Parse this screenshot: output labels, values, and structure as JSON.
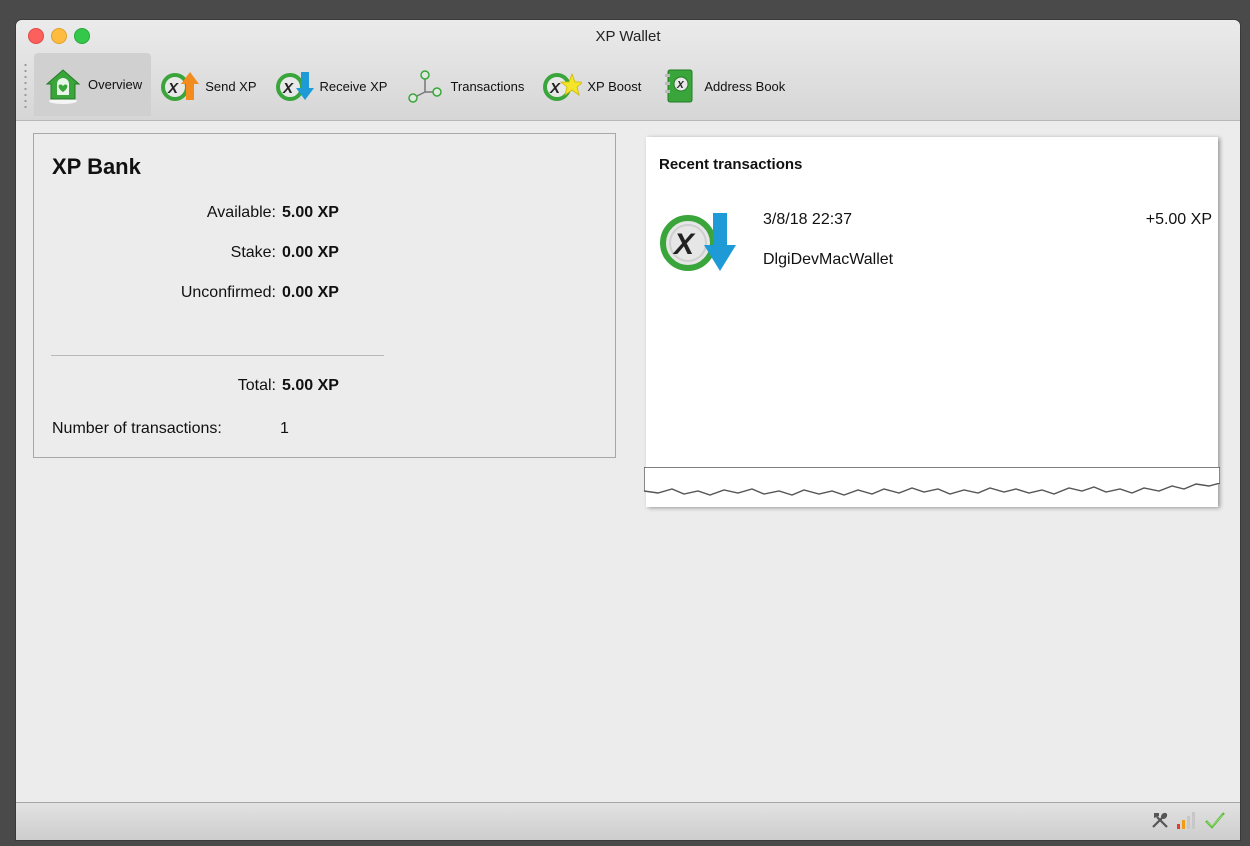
{
  "window": {
    "title": "XP Wallet"
  },
  "toolbar": {
    "tabs": [
      {
        "label": "Overview",
        "icon": "house-icon",
        "active": true
      },
      {
        "label": "Send XP",
        "icon": "send-xp-icon",
        "active": false
      },
      {
        "label": "Receive XP",
        "icon": "receive-xp-icon",
        "active": false
      },
      {
        "label": "Transactions",
        "icon": "transactions-icon",
        "active": false
      },
      {
        "label": "XP Boost",
        "icon": "xp-boost-icon",
        "active": false
      },
      {
        "label": "Address Book",
        "icon": "address-book-icon",
        "active": false
      }
    ]
  },
  "bank": {
    "title": "XP Bank",
    "available_label": "Available:",
    "available_value": "5.00 XP",
    "stake_label": "Stake:",
    "stake_value": "0.00 XP",
    "unconfirmed_label": "Unconfirmed:",
    "unconfirmed_value": "0.00 XP",
    "total_label": "Total:",
    "total_value": "5.00 XP",
    "num_tx_label": "Number of transactions:",
    "num_tx_value": "1"
  },
  "recent": {
    "title": "Recent transactions",
    "transactions": [
      {
        "date": "3/8/18 22:37",
        "amount": "+5.00 XP",
        "label": "DlgiDevMacWallet",
        "icon": "receive-xp-icon"
      }
    ]
  },
  "statusbar": {
    "icons": [
      "tools-icon",
      "signal-bars-icon",
      "synced-check-icon"
    ]
  },
  "colors": {
    "brand_green": "#3aa53a",
    "send_orange": "#f28c1e",
    "receive_blue": "#1e9ad6",
    "close": "#fc605c",
    "minimize": "#fdbc40",
    "maximize": "#34c84a"
  }
}
